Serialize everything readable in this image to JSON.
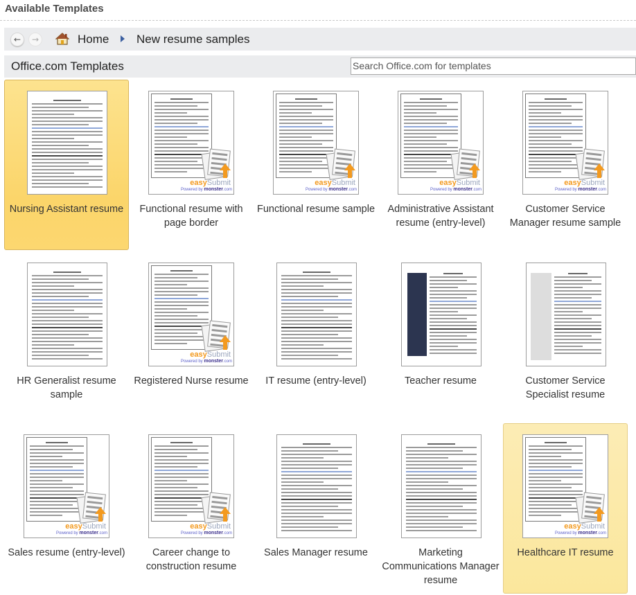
{
  "header": {
    "title": "Available Templates"
  },
  "nav": {
    "back_icon": "back-arrow-icon",
    "forward_icon": "forward-arrow-icon",
    "home_icon": "home-icon",
    "breadcrumb": [
      {
        "label": "Home"
      },
      {
        "label": "New resume samples"
      }
    ]
  },
  "section": {
    "title": "Office.com Templates",
    "search_placeholder": "Search Office.com for templates"
  },
  "colors": {
    "selected_bg": "#fbd56a",
    "hover_bg": "#fbe79c",
    "easysubmit_orange": "#f39a1f",
    "toolbar_bg": "#ebecee"
  },
  "badge": {
    "easy": "easy",
    "submit": "Submit",
    "powered": "Powered by",
    "monster": "monster",
    "com": ".com"
  },
  "templates": [
    {
      "label": "Nursing Assistant resume",
      "state": "selected",
      "easysubmit": false
    },
    {
      "label": "Functional resume with page border",
      "state": "normal",
      "easysubmit": true
    },
    {
      "label": "Functional resume sample",
      "state": "normal",
      "easysubmit": true
    },
    {
      "label": "Administrative Assistant resume (entry-level)",
      "state": "normal",
      "easysubmit": true
    },
    {
      "label": "Customer Service Manager resume sample",
      "state": "normal",
      "easysubmit": true
    },
    {
      "label": "HR Generalist resume sample",
      "state": "normal",
      "easysubmit": false
    },
    {
      "label": "Registered Nurse resume",
      "state": "normal",
      "easysubmit": true
    },
    {
      "label": "IT resume (entry-level)",
      "state": "normal",
      "easysubmit": false
    },
    {
      "label": "Teacher resume",
      "state": "normal",
      "easysubmit": false
    },
    {
      "label": "Customer Service Specialist resume",
      "state": "normal",
      "easysubmit": false
    },
    {
      "label": "Sales resume (entry-level)",
      "state": "normal",
      "easysubmit": true
    },
    {
      "label": "Career change to construction resume",
      "state": "normal",
      "easysubmit": true
    },
    {
      "label": "Sales Manager resume",
      "state": "normal",
      "easysubmit": false
    },
    {
      "label": "Marketing Communications Manager resume",
      "state": "normal",
      "easysubmit": false
    },
    {
      "label": "Healthcare IT resume",
      "state": "hover",
      "easysubmit": true
    }
  ]
}
